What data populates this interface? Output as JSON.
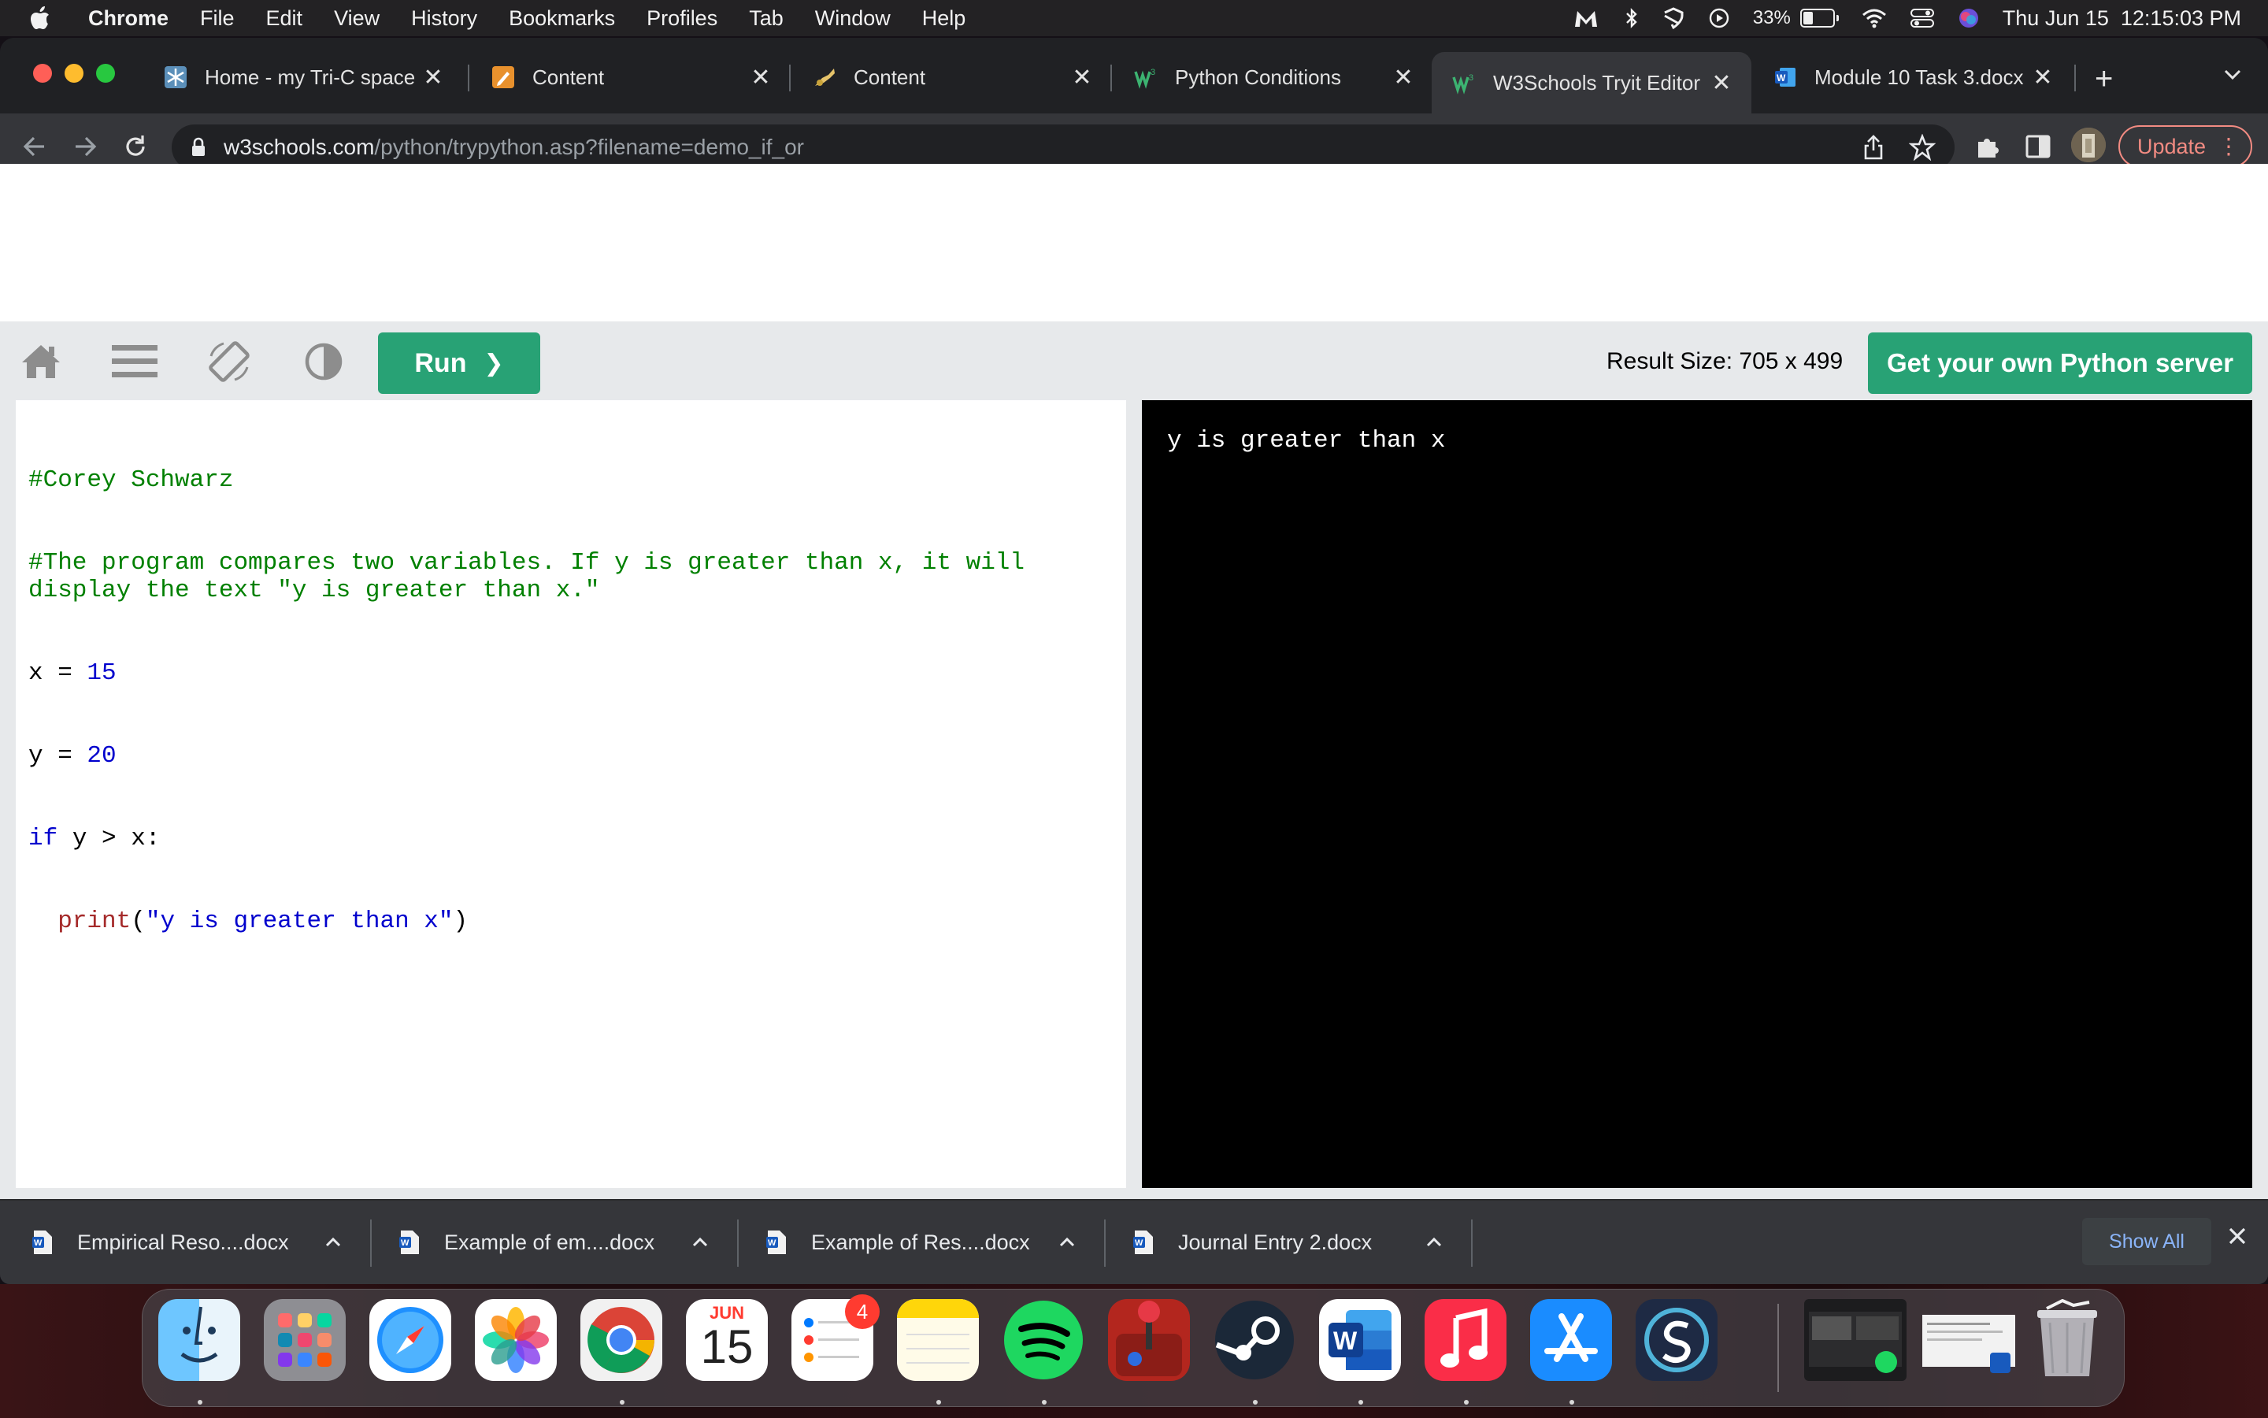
{
  "menubar": {
    "app_name": "Chrome",
    "menus": [
      "File",
      "Edit",
      "View",
      "History",
      "Bookmarks",
      "Profiles",
      "Tab",
      "Window",
      "Help"
    ],
    "battery_percent": "33%",
    "battery_level": 0.33,
    "datetime": "Thu Jun 15  12:15:03 PM"
  },
  "browser": {
    "tabs": [
      {
        "title": "Home - my Tri-C space",
        "favicon": "snowflake-icon"
      },
      {
        "title": "Content",
        "favicon": "pencil-icon"
      },
      {
        "title": "Content",
        "favicon": "trumpet-icon"
      },
      {
        "title": "Python Conditions",
        "favicon": "w3schools-icon"
      },
      {
        "title": "W3Schools Tryit Editor",
        "favicon": "w3schools-icon",
        "active": true
      },
      {
        "title": "Module 10 Task 3.docx",
        "favicon": "word-icon"
      }
    ],
    "tab_close_glyph": "✕",
    "new_tab_glyph": "+",
    "url_host": "w3schools.com",
    "url_path": "/python/trypython.asp?filename=demo_if_or",
    "update_label": "Update"
  },
  "tryit": {
    "run_label": "Run",
    "run_glyph": "❯",
    "result_size": "Result Size: 705 x 499",
    "server_button": "Get your own Python server",
    "code_lines": [
      "#Corey Schwarz",
      "#The program compares two variables. If y is greater than x, it will display the text \"y is greater than x.\"",
      "x = 15",
      "y = 20",
      "if y > x:",
      "  print(\"y is greater than x\")"
    ],
    "code_tokens": {
      "x_var": "x",
      "y_var": "y",
      "assign": " = ",
      "x_value": "15",
      "y_value": "20",
      "if_kw": "if",
      "condition": " y > x:",
      "indent": "  ",
      "print_fn": "print",
      "open_paren": "(",
      "print_arg": "\"y is greater than x\"",
      "close_paren": ")"
    },
    "output": "y is greater than x"
  },
  "downloads": {
    "items": [
      {
        "name": "Empirical Reso....docx"
      },
      {
        "name": "Example of em....docx"
      },
      {
        "name": "Example of Res....docx"
      },
      {
        "name": "Journal Entry 2.docx"
      }
    ],
    "show_all": "Show All",
    "close_glyph": "✕"
  },
  "dock": {
    "apps": [
      "Finder",
      "Launchpad",
      "Safari",
      "Photos",
      "Google Chrome",
      "Calendar",
      "Reminders",
      "Notes",
      "Spotify",
      "Joystick",
      "Steam",
      "Microsoft Word",
      "Music",
      "App Store",
      "Scrivener"
    ],
    "calendar_month": "JUN",
    "calendar_day": "15",
    "reminders_badge": "4"
  },
  "colors": {
    "w3_green": "#04aa6d",
    "chrome_dark": "#202124",
    "chrome_toolbar": "#35363a",
    "comment_green": "#008000",
    "keyword_blue": "#0000cd",
    "function_brown": "#a52a2a"
  }
}
